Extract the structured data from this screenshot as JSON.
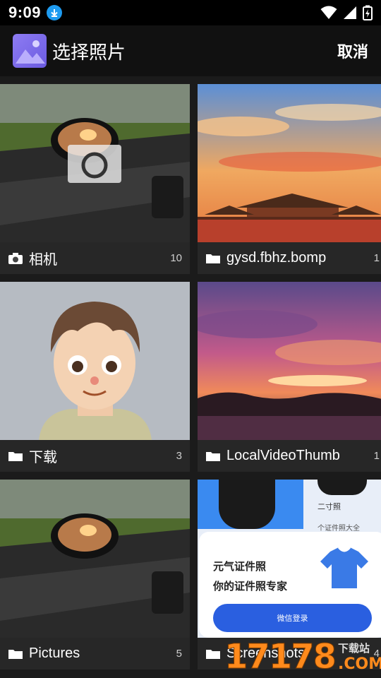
{
  "status_bar": {
    "time": "9:09"
  },
  "header": {
    "title": "选择照片",
    "cancel_label": "取消"
  },
  "albums": [
    {
      "name": "相机",
      "count": "10",
      "icon": "camera-icon"
    },
    {
      "name": "gysd.fbhz.bomp",
      "count": "1",
      "icon": "folder-icon"
    },
    {
      "name": "下载",
      "count": "3",
      "icon": "folder-icon"
    },
    {
      "name": "LocalVideoThumb",
      "count": "1",
      "icon": "folder-icon"
    },
    {
      "name": "Pictures",
      "count": "5",
      "icon": "folder-icon"
    },
    {
      "name": "Screenshots",
      "count": "4",
      "icon": "folder-icon"
    }
  ],
  "screenshot_thumb": {
    "label_top": "二寸照",
    "label_mid": "个证件照大全",
    "line1": "元气证件照",
    "line2": "你的证件照专家",
    "button": "微信登录"
  },
  "watermark": {
    "number": "17178",
    "site_cn": "下载站",
    "site_en": ".COM"
  }
}
